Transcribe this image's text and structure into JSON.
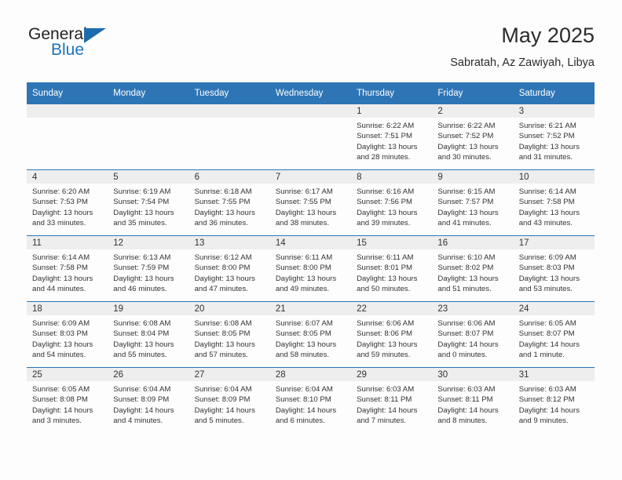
{
  "brand": {
    "name_part1": "General",
    "name_part2": "Blue",
    "logo_icon": "triangle-flag-icon"
  },
  "header": {
    "title": "May 2025",
    "subtitle": "Sabratah, Az Zawiyah, Libya"
  },
  "colors": {
    "header_blue": "#2e75b6",
    "brand_blue": "#1b75bb",
    "daynum_band": "#eeeeee",
    "page_background": "#fdfdfd",
    "text": "#333333"
  },
  "weekday_headers": [
    "Sunday",
    "Monday",
    "Tuesday",
    "Wednesday",
    "Thursday",
    "Friday",
    "Saturday"
  ],
  "weeks": [
    [
      {
        "day": "",
        "empty": true
      },
      {
        "day": "",
        "empty": true
      },
      {
        "day": "",
        "empty": true
      },
      {
        "day": "",
        "empty": true
      },
      {
        "day": "1",
        "sunrise": "Sunrise: 6:22 AM",
        "sunset": "Sunset: 7:51 PM",
        "daylight_l1": "Daylight: 13 hours",
        "daylight_l2": "and 28 minutes."
      },
      {
        "day": "2",
        "sunrise": "Sunrise: 6:22 AM",
        "sunset": "Sunset: 7:52 PM",
        "daylight_l1": "Daylight: 13 hours",
        "daylight_l2": "and 30 minutes."
      },
      {
        "day": "3",
        "sunrise": "Sunrise: 6:21 AM",
        "sunset": "Sunset: 7:52 PM",
        "daylight_l1": "Daylight: 13 hours",
        "daylight_l2": "and 31 minutes."
      }
    ],
    [
      {
        "day": "4",
        "sunrise": "Sunrise: 6:20 AM",
        "sunset": "Sunset: 7:53 PM",
        "daylight_l1": "Daylight: 13 hours",
        "daylight_l2": "and 33 minutes."
      },
      {
        "day": "5",
        "sunrise": "Sunrise: 6:19 AM",
        "sunset": "Sunset: 7:54 PM",
        "daylight_l1": "Daylight: 13 hours",
        "daylight_l2": "and 35 minutes."
      },
      {
        "day": "6",
        "sunrise": "Sunrise: 6:18 AM",
        "sunset": "Sunset: 7:55 PM",
        "daylight_l1": "Daylight: 13 hours",
        "daylight_l2": "and 36 minutes."
      },
      {
        "day": "7",
        "sunrise": "Sunrise: 6:17 AM",
        "sunset": "Sunset: 7:55 PM",
        "daylight_l1": "Daylight: 13 hours",
        "daylight_l2": "and 38 minutes."
      },
      {
        "day": "8",
        "sunrise": "Sunrise: 6:16 AM",
        "sunset": "Sunset: 7:56 PM",
        "daylight_l1": "Daylight: 13 hours",
        "daylight_l2": "and 39 minutes."
      },
      {
        "day": "9",
        "sunrise": "Sunrise: 6:15 AM",
        "sunset": "Sunset: 7:57 PM",
        "daylight_l1": "Daylight: 13 hours",
        "daylight_l2": "and 41 minutes."
      },
      {
        "day": "10",
        "sunrise": "Sunrise: 6:14 AM",
        "sunset": "Sunset: 7:58 PM",
        "daylight_l1": "Daylight: 13 hours",
        "daylight_l2": "and 43 minutes."
      }
    ],
    [
      {
        "day": "11",
        "sunrise": "Sunrise: 6:14 AM",
        "sunset": "Sunset: 7:58 PM",
        "daylight_l1": "Daylight: 13 hours",
        "daylight_l2": "and 44 minutes."
      },
      {
        "day": "12",
        "sunrise": "Sunrise: 6:13 AM",
        "sunset": "Sunset: 7:59 PM",
        "daylight_l1": "Daylight: 13 hours",
        "daylight_l2": "and 46 minutes."
      },
      {
        "day": "13",
        "sunrise": "Sunrise: 6:12 AM",
        "sunset": "Sunset: 8:00 PM",
        "daylight_l1": "Daylight: 13 hours",
        "daylight_l2": "and 47 minutes."
      },
      {
        "day": "14",
        "sunrise": "Sunrise: 6:11 AM",
        "sunset": "Sunset: 8:00 PM",
        "daylight_l1": "Daylight: 13 hours",
        "daylight_l2": "and 49 minutes."
      },
      {
        "day": "15",
        "sunrise": "Sunrise: 6:11 AM",
        "sunset": "Sunset: 8:01 PM",
        "daylight_l1": "Daylight: 13 hours",
        "daylight_l2": "and 50 minutes."
      },
      {
        "day": "16",
        "sunrise": "Sunrise: 6:10 AM",
        "sunset": "Sunset: 8:02 PM",
        "daylight_l1": "Daylight: 13 hours",
        "daylight_l2": "and 51 minutes."
      },
      {
        "day": "17",
        "sunrise": "Sunrise: 6:09 AM",
        "sunset": "Sunset: 8:03 PM",
        "daylight_l1": "Daylight: 13 hours",
        "daylight_l2": "and 53 minutes."
      }
    ],
    [
      {
        "day": "18",
        "sunrise": "Sunrise: 6:09 AM",
        "sunset": "Sunset: 8:03 PM",
        "daylight_l1": "Daylight: 13 hours",
        "daylight_l2": "and 54 minutes."
      },
      {
        "day": "19",
        "sunrise": "Sunrise: 6:08 AM",
        "sunset": "Sunset: 8:04 PM",
        "daylight_l1": "Daylight: 13 hours",
        "daylight_l2": "and 55 minutes."
      },
      {
        "day": "20",
        "sunrise": "Sunrise: 6:08 AM",
        "sunset": "Sunset: 8:05 PM",
        "daylight_l1": "Daylight: 13 hours",
        "daylight_l2": "and 57 minutes."
      },
      {
        "day": "21",
        "sunrise": "Sunrise: 6:07 AM",
        "sunset": "Sunset: 8:05 PM",
        "daylight_l1": "Daylight: 13 hours",
        "daylight_l2": "and 58 minutes."
      },
      {
        "day": "22",
        "sunrise": "Sunrise: 6:06 AM",
        "sunset": "Sunset: 8:06 PM",
        "daylight_l1": "Daylight: 13 hours",
        "daylight_l2": "and 59 minutes."
      },
      {
        "day": "23",
        "sunrise": "Sunrise: 6:06 AM",
        "sunset": "Sunset: 8:07 PM",
        "daylight_l1": "Daylight: 14 hours",
        "daylight_l2": "and 0 minutes."
      },
      {
        "day": "24",
        "sunrise": "Sunrise: 6:05 AM",
        "sunset": "Sunset: 8:07 PM",
        "daylight_l1": "Daylight: 14 hours",
        "daylight_l2": "and 1 minute."
      }
    ],
    [
      {
        "day": "25",
        "sunrise": "Sunrise: 6:05 AM",
        "sunset": "Sunset: 8:08 PM",
        "daylight_l1": "Daylight: 14 hours",
        "daylight_l2": "and 3 minutes."
      },
      {
        "day": "26",
        "sunrise": "Sunrise: 6:04 AM",
        "sunset": "Sunset: 8:09 PM",
        "daylight_l1": "Daylight: 14 hours",
        "daylight_l2": "and 4 minutes."
      },
      {
        "day": "27",
        "sunrise": "Sunrise: 6:04 AM",
        "sunset": "Sunset: 8:09 PM",
        "daylight_l1": "Daylight: 14 hours",
        "daylight_l2": "and 5 minutes."
      },
      {
        "day": "28",
        "sunrise": "Sunrise: 6:04 AM",
        "sunset": "Sunset: 8:10 PM",
        "daylight_l1": "Daylight: 14 hours",
        "daylight_l2": "and 6 minutes."
      },
      {
        "day": "29",
        "sunrise": "Sunrise: 6:03 AM",
        "sunset": "Sunset: 8:11 PM",
        "daylight_l1": "Daylight: 14 hours",
        "daylight_l2": "and 7 minutes."
      },
      {
        "day": "30",
        "sunrise": "Sunrise: 6:03 AM",
        "sunset": "Sunset: 8:11 PM",
        "daylight_l1": "Daylight: 14 hours",
        "daylight_l2": "and 8 minutes."
      },
      {
        "day": "31",
        "sunrise": "Sunrise: 6:03 AM",
        "sunset": "Sunset: 8:12 PM",
        "daylight_l1": "Daylight: 14 hours",
        "daylight_l2": "and 9 minutes."
      }
    ]
  ]
}
